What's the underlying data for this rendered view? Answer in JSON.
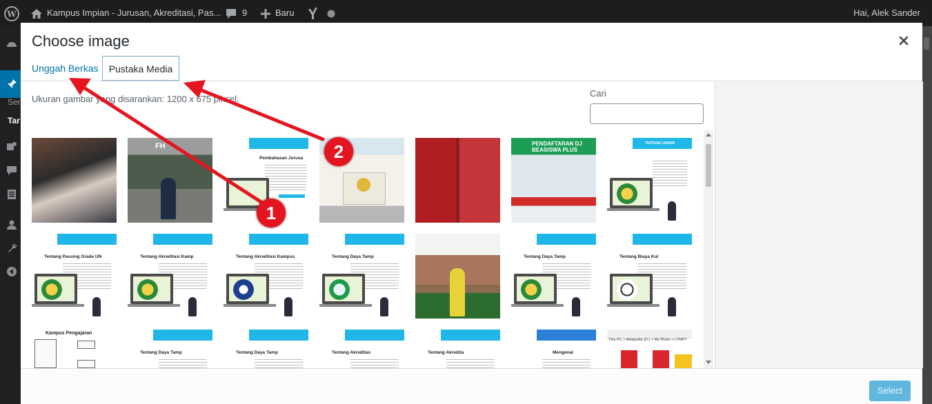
{
  "admin_bar": {
    "site_title": "Kampus Impian - Jurusan, Akreditasi, Pas...",
    "comment_count": "9",
    "new_label": "Baru",
    "howdy": "Hai, Alek Sander"
  },
  "sidebar": {
    "text_1": "Sem",
    "text_2": "Tar"
  },
  "modal": {
    "title": "Choose image",
    "tabs": [
      {
        "label": "Unggah Berkas"
      },
      {
        "label": "Pustaka Media"
      }
    ],
    "hint": "Ukuran gambar yang disarankan: 1200 x 675 piksel.",
    "search_label": "Cari",
    "search_value": "",
    "select_label": "Select"
  },
  "thumbs": [
    {
      "kind": "photo",
      "caption": ""
    },
    {
      "kind": "photo",
      "caption": "FH"
    },
    {
      "kind": "slide",
      "caption": "Pembahasan Jurusa"
    },
    {
      "kind": "photo",
      "caption": ""
    },
    {
      "kind": "photo",
      "caption": ""
    },
    {
      "kind": "photo",
      "caption": "PENDAFTARAN DJ BEASISWA PLUS"
    },
    {
      "kind": "slide",
      "caption": "TENTANG UNAND"
    },
    {
      "kind": "slide",
      "caption": "Tentang Passing Grade UN"
    },
    {
      "kind": "slide",
      "caption": "Tentang Akreditasi Kamp"
    },
    {
      "kind": "slide",
      "caption": "Tentang Akreditasi Kampus"
    },
    {
      "kind": "slide",
      "caption": "Tentang Daya Tamp"
    },
    {
      "kind": "photo",
      "caption": ""
    },
    {
      "kind": "slide",
      "caption": "Tentang Daya Tamp"
    },
    {
      "kind": "slide",
      "caption": "Tentang Biaya Kul"
    },
    {
      "kind": "chart",
      "caption": "Kampus Pengajaran"
    },
    {
      "kind": "slide",
      "caption": "Tentang Daya Tamp"
    },
    {
      "kind": "slide",
      "caption": "Tentang Daya Tamp"
    },
    {
      "kind": "slide",
      "caption": "Tentang Akreditas"
    },
    {
      "kind": "slide",
      "caption": "Tentang Akredita"
    },
    {
      "kind": "slide",
      "caption": "Mengenal"
    },
    {
      "kind": "explorer",
      "caption": "This PC > Alekpedia (D:) > My Photo > LTMPT"
    }
  ],
  "annotations": [
    {
      "label": "1"
    },
    {
      "label": "2"
    }
  ],
  "colors": {
    "admin_bar": "#1d1d1d",
    "accent": "#0073aa",
    "select_button": "#5fb7de",
    "annotation": "#e4151f",
    "slide_band": "#1fb6e8"
  }
}
